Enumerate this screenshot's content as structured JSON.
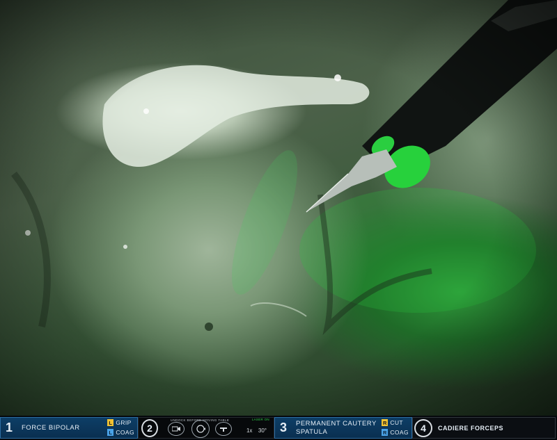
{
  "hud": {
    "arm1": {
      "number": "1",
      "name": "FORCE BIPOLAR",
      "modes": [
        {
          "key": "L",
          "label": "GRIP",
          "color": "#f1c232"
        },
        {
          "key": "L",
          "label": "COAG",
          "color": "#4aa3e8"
        }
      ]
    },
    "arm2": {
      "number": "2",
      "message": "UNDOCK BEFORE MOVING TABLE",
      "laser": "LASER ON",
      "zoom": "1x",
      "angle": "30°"
    },
    "arm3": {
      "number": "3",
      "name_line1": "PERMANENT CAUTERY",
      "name_line2": "SPATULA",
      "modes": [
        {
          "key": "R",
          "label": "CUT",
          "color": "#f1c232"
        },
        {
          "key": "R",
          "label": "COAG",
          "color": "#4aa3e8"
        }
      ]
    },
    "arm4": {
      "number": "4",
      "name": "CADIERE FORCEPS"
    }
  },
  "icons": {
    "camera": "camera-icon",
    "rotate": "rotate-icon",
    "table": "table-icon"
  }
}
